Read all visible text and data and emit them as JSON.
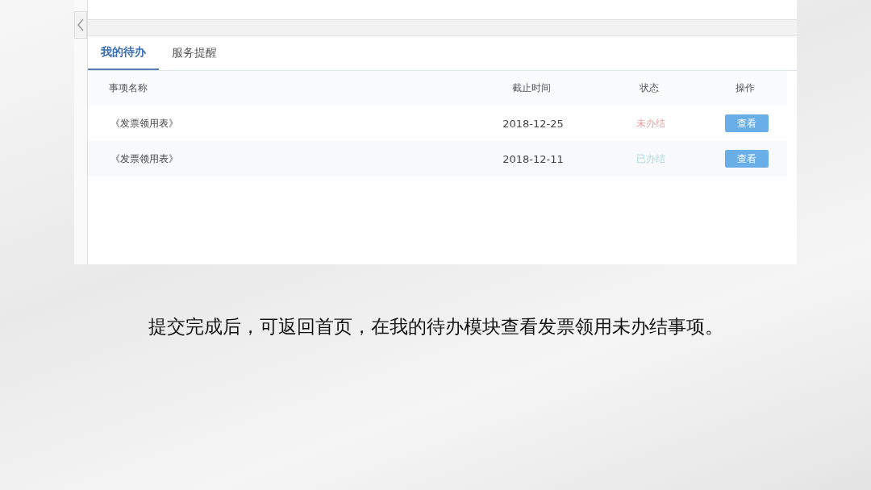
{
  "tabs": [
    {
      "label": "我的待办",
      "selected": true
    },
    {
      "label": "服务提醒",
      "selected": false
    }
  ],
  "table": {
    "columns": [
      "事项名称",
      "截止时间",
      "状态",
      "操作"
    ],
    "rows": [
      {
        "name": "《发票领用表》",
        "deadline": "2018-12-25",
        "status": "未办结",
        "color": "#e8a0a0",
        "action": "查看"
      },
      {
        "name": "《发票领用表》",
        "deadline": "2018-12-11",
        "status": "已办结",
        "color": "#a8d8e0",
        "action": "查看"
      }
    ]
  },
  "caption": "提交完成后，可返回首页，在我的待办模块查看发票领用未办结事项。"
}
